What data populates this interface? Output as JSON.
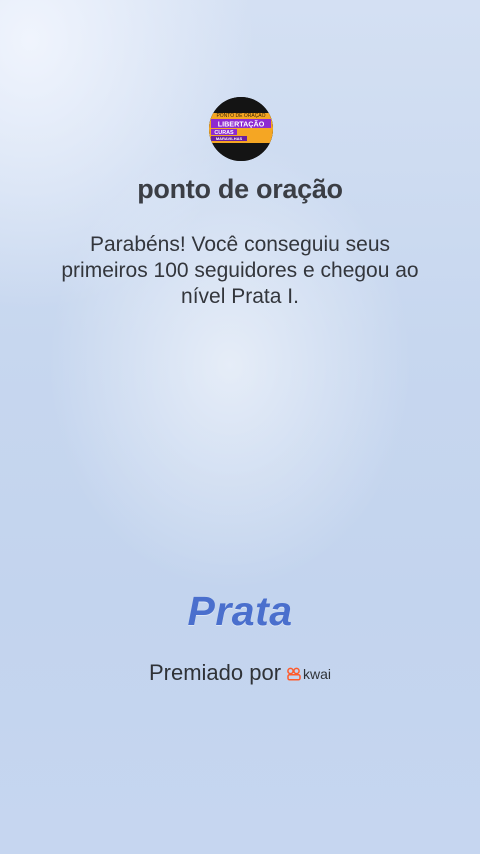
{
  "profile": {
    "avatar_lines": [
      "PONTO DE ORAÇÃO",
      "LIBERTAÇÃO",
      "CURAS",
      "MARAVILHAS"
    ],
    "name": "ponto de oração"
  },
  "message": "Parabéns! Você conseguiu seus primeiros 100 seguidores e chegou ao nível Prata I.",
  "level": "Prata",
  "award": {
    "label": "Premiado por",
    "brand": "kwai",
    "brand_icon": "kwai-logo-icon",
    "brand_color": "#ff5a2a"
  },
  "colors": {
    "level_text": "#4a6fcd",
    "avatar_banner": "#f5a623",
    "avatar_highlight": "#8e2bd1"
  }
}
